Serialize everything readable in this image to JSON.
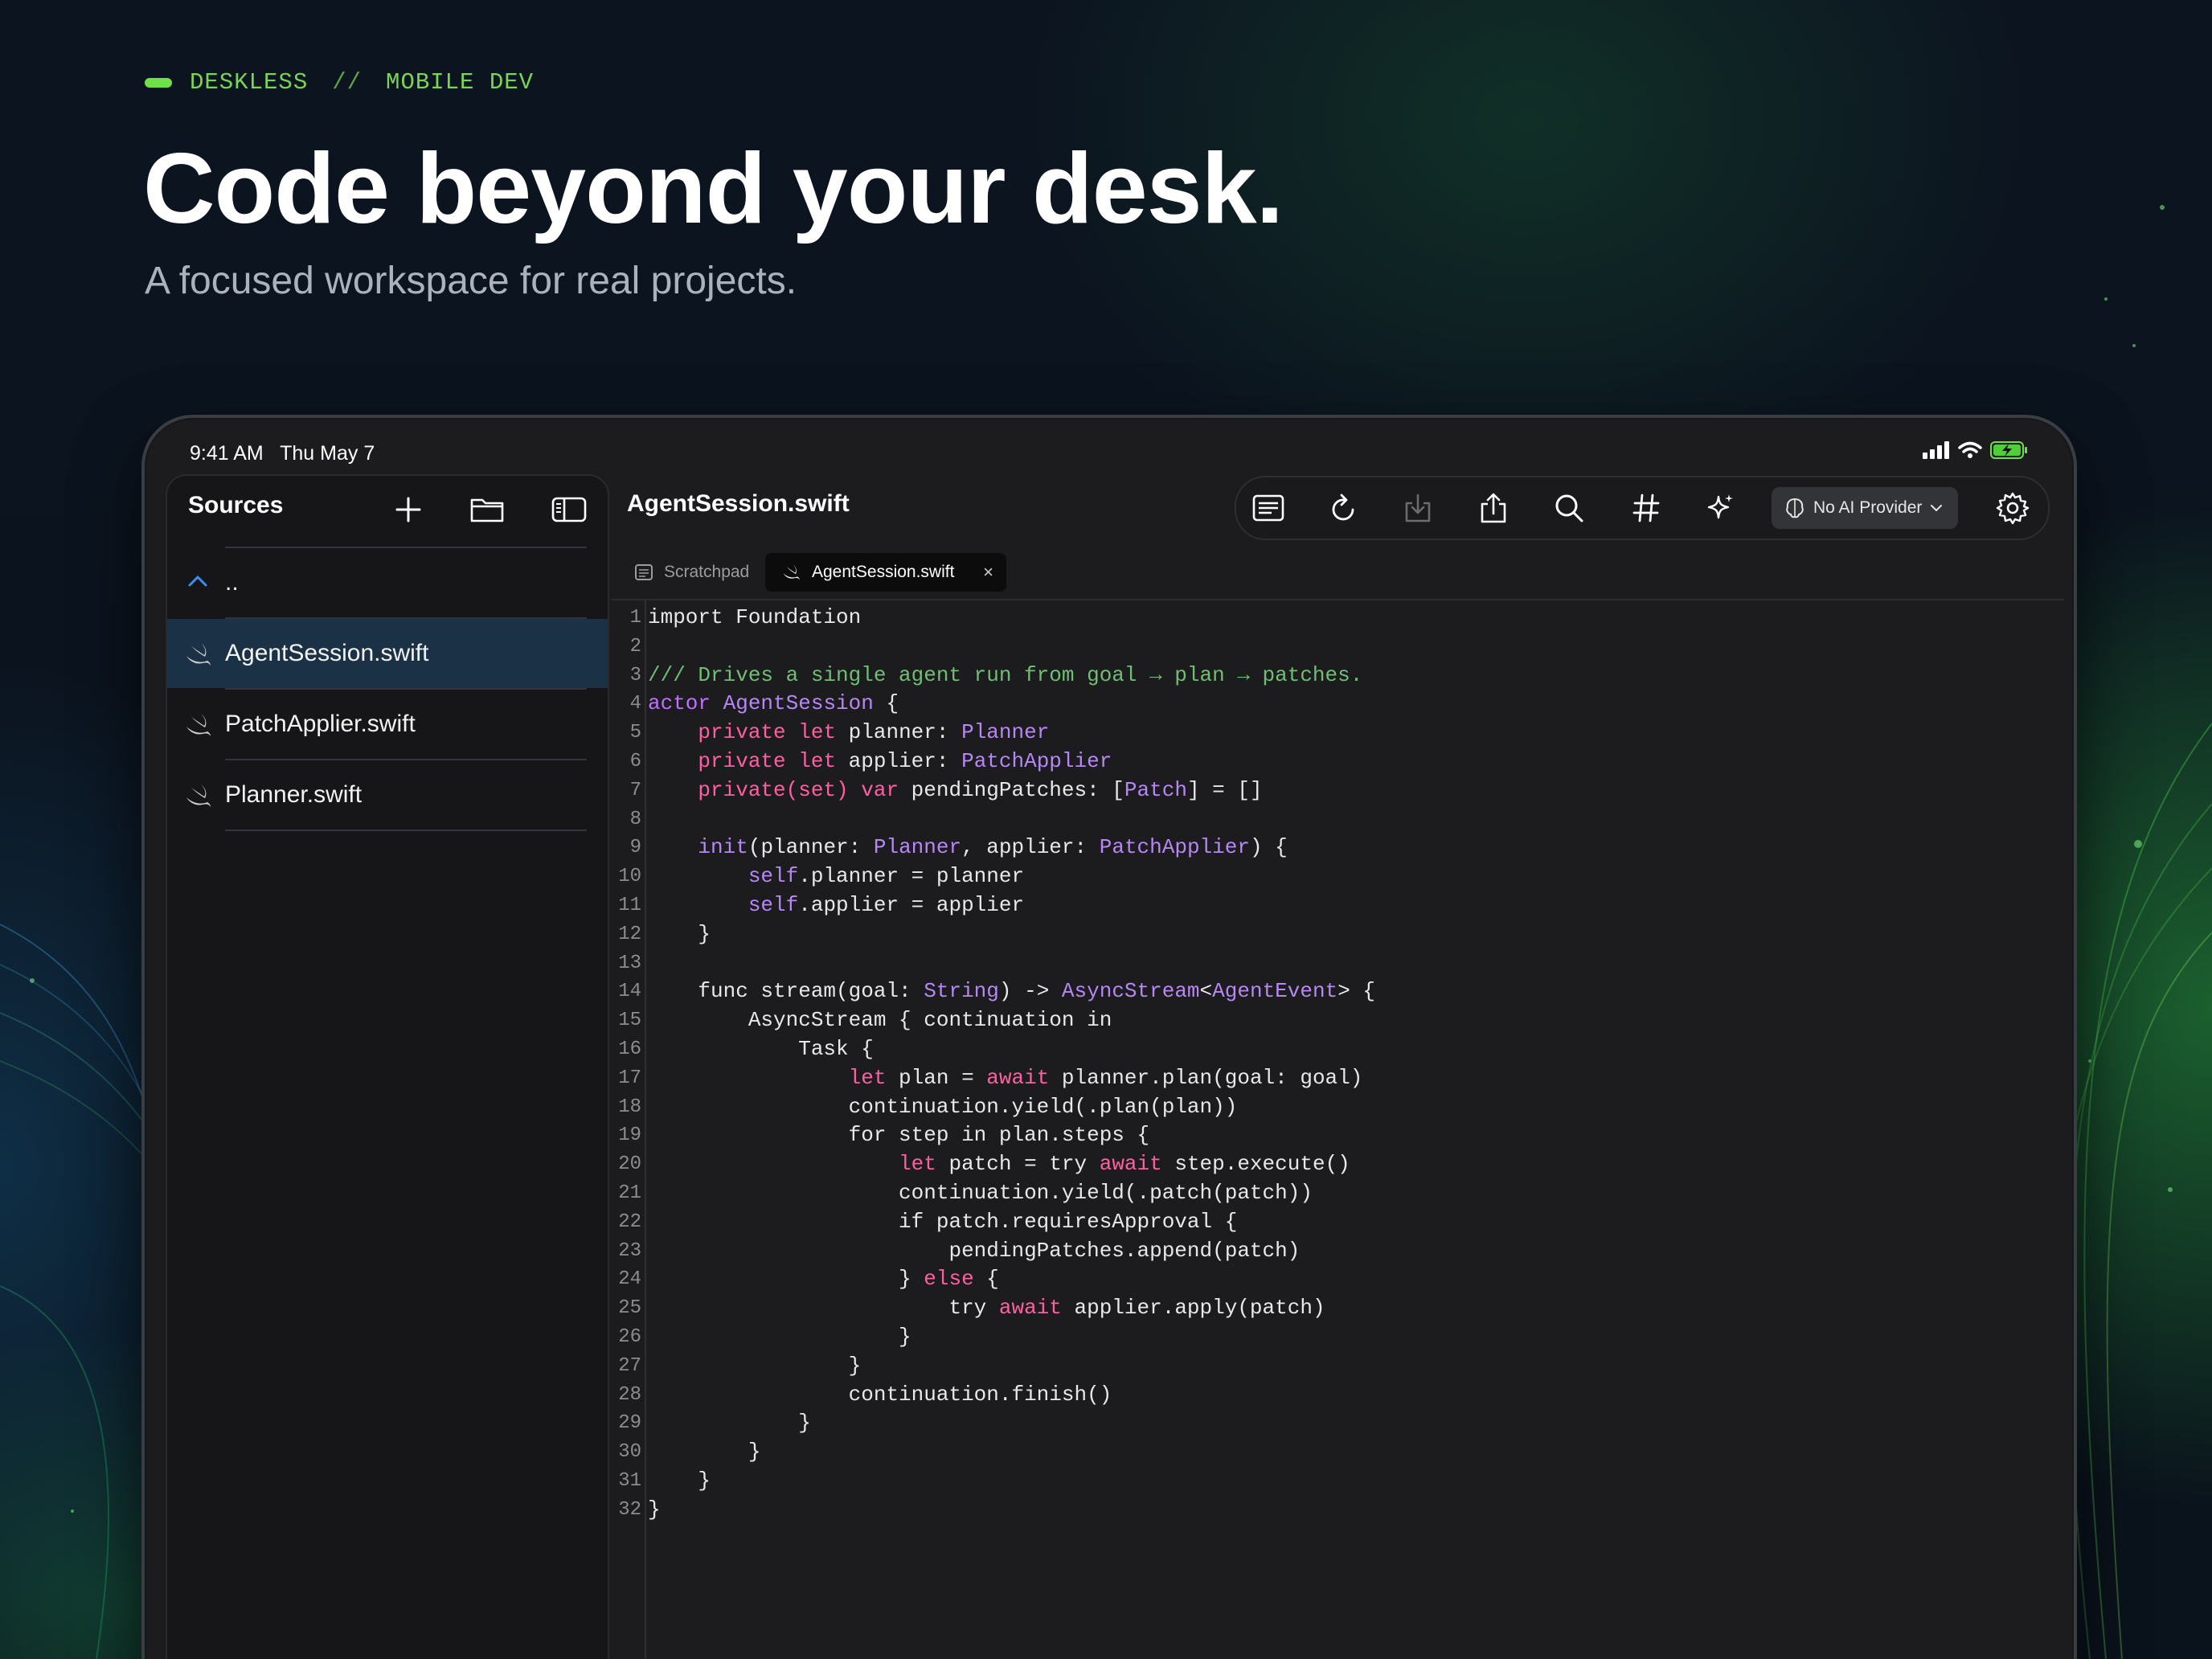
{
  "eyebrow": {
    "brand": "DESKLESS",
    "separator": "//",
    "category": "MOBILE DEV"
  },
  "headline": "Code beyond your desk.",
  "subhead": "A focused workspace for real projects.",
  "status": {
    "time": "9:41 AM",
    "date": "Thu May 7"
  },
  "sidebar": {
    "title": "Sources",
    "parent_label": "..",
    "items": [
      {
        "label": "AgentSession.swift",
        "selected": true
      },
      {
        "label": "PatchApplier.swift",
        "selected": false
      },
      {
        "label": "Planner.swift",
        "selected": false
      }
    ]
  },
  "editor": {
    "file_title": "AgentSession.swift",
    "ai_provider": "No AI Provider",
    "tabs": [
      {
        "label": "Scratchpad",
        "active": false
      },
      {
        "label": "AgentSession.swift",
        "active": true,
        "close": "×"
      }
    ]
  },
  "colors": {
    "accent_green": "#6fe04b",
    "selection": "#1b3246",
    "comment": "#6fbf73",
    "keyword": "#ff5fa2",
    "type": "#b687f5"
  },
  "code": [
    [
      {
        "t": "import Foundation"
      }
    ],
    [],
    [
      {
        "t": "/// Drives a single agent run from goal → plan → patches.",
        "c": "comment"
      }
    ],
    [
      {
        "t": "actor ",
        "c": "kw2"
      },
      {
        "t": "AgentSession",
        "c": "type"
      },
      {
        "t": " {"
      }
    ],
    [
      {
        "t": "    "
      },
      {
        "t": "private let",
        "c": "kw"
      },
      {
        "t": " planner: "
      },
      {
        "t": "Planner",
        "c": "type"
      }
    ],
    [
      {
        "t": "    "
      },
      {
        "t": "private let",
        "c": "kw"
      },
      {
        "t": " applier: "
      },
      {
        "t": "PatchApplier",
        "c": "type"
      }
    ],
    [
      {
        "t": "    "
      },
      {
        "t": "private(set) var",
        "c": "kw"
      },
      {
        "t": " pendingPatches: ["
      },
      {
        "t": "Patch",
        "c": "type"
      },
      {
        "t": "] = []"
      }
    ],
    [],
    [
      {
        "t": "    "
      },
      {
        "t": "init",
        "c": "type"
      },
      {
        "t": "(planner: "
      },
      {
        "t": "Planner",
        "c": "type"
      },
      {
        "t": ", applier: "
      },
      {
        "t": "PatchApplier",
        "c": "type"
      },
      {
        "t": ") {"
      }
    ],
    [
      {
        "t": "        "
      },
      {
        "t": "self",
        "c": "type"
      },
      {
        "t": ".planner = planner"
      }
    ],
    [
      {
        "t": "        "
      },
      {
        "t": "self",
        "c": "type"
      },
      {
        "t": ".applier = applier"
      }
    ],
    [
      {
        "t": "    }"
      }
    ],
    [],
    [
      {
        "t": "    func stream(goal: "
      },
      {
        "t": "String",
        "c": "type"
      },
      {
        "t": ") -> "
      },
      {
        "t": "AsyncStream",
        "c": "type"
      },
      {
        "t": "<"
      },
      {
        "t": "AgentEvent",
        "c": "type"
      },
      {
        "t": "> {"
      }
    ],
    [
      {
        "t": "        AsyncStream { continuation in"
      }
    ],
    [
      {
        "t": "            Task {"
      }
    ],
    [
      {
        "t": "                "
      },
      {
        "t": "let",
        "c": "kw"
      },
      {
        "t": " plan = "
      },
      {
        "t": "await",
        "c": "kw"
      },
      {
        "t": " planner.plan(goal: goal)"
      }
    ],
    [
      {
        "t": "                continuation.yield(.plan(plan))"
      }
    ],
    [
      {
        "t": "                for step in plan.steps {"
      }
    ],
    [
      {
        "t": "                    "
      },
      {
        "t": "let",
        "c": "kw"
      },
      {
        "t": " patch = try "
      },
      {
        "t": "await",
        "c": "kw"
      },
      {
        "t": " step.execute()"
      }
    ],
    [
      {
        "t": "                    continuation.yield(.patch(patch))"
      }
    ],
    [
      {
        "t": "                    if patch.requiresApproval {"
      }
    ],
    [
      {
        "t": "                        pendingPatches.append(patch)"
      }
    ],
    [
      {
        "t": "                    } "
      },
      {
        "t": "else",
        "c": "kw"
      },
      {
        "t": " {"
      }
    ],
    [
      {
        "t": "                        try "
      },
      {
        "t": "await",
        "c": "kw"
      },
      {
        "t": " applier.apply(patch)"
      }
    ],
    [
      {
        "t": "                    }"
      }
    ],
    [
      {
        "t": "                }"
      }
    ],
    [
      {
        "t": "                continuation.finish()"
      }
    ],
    [
      {
        "t": "            }"
      }
    ],
    [
      {
        "t": "        }"
      }
    ],
    [
      {
        "t": "    }"
      }
    ],
    [
      {
        "t": "}"
      }
    ]
  ]
}
